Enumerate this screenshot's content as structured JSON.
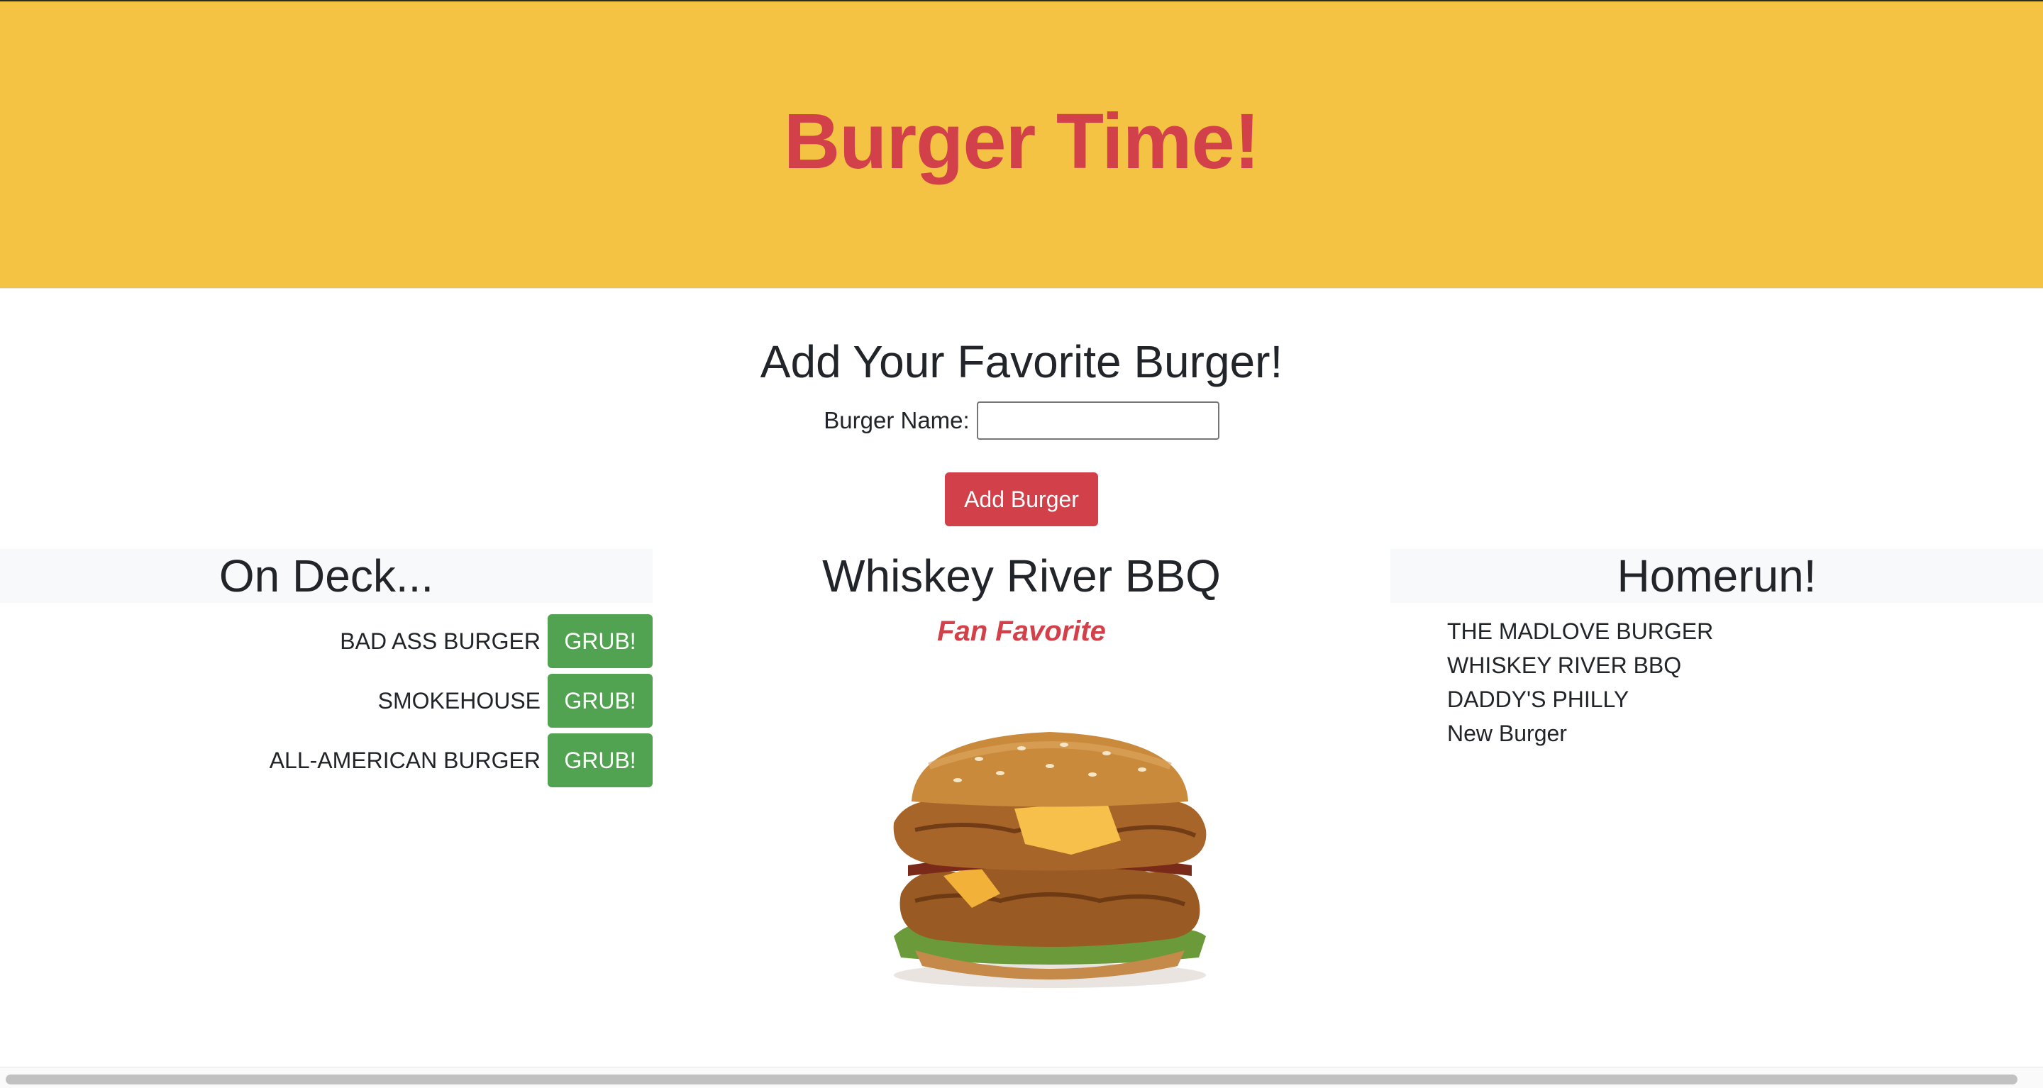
{
  "header": {
    "title": "Burger Time!"
  },
  "form": {
    "heading": "Add Your Favorite Burger!",
    "label": "Burger Name:",
    "input_value": "",
    "input_placeholder": "",
    "submit_label": "Add Burger"
  },
  "on_deck": {
    "heading": "On Deck...",
    "items": [
      {
        "name": "BAD ASS BURGER",
        "button": "GRUB!"
      },
      {
        "name": "SMOKEHOUSE",
        "button": "GRUB!"
      },
      {
        "name": "ALL-AMERICAN BURGER",
        "button": "GRUB!"
      }
    ]
  },
  "feature": {
    "title": "Whiskey River BBQ",
    "subtitle": "Fan Favorite",
    "image_icon": "burger-image"
  },
  "homerun": {
    "heading": "Homerun!",
    "items": [
      "THE MADLOVE BURGER",
      "WHISKEY RIVER BBQ",
      "DADDY'S PHILLY",
      "New Burger"
    ]
  },
  "colors": {
    "hero_bg": "#f5c344",
    "accent_red": "#d2404a",
    "grub_green": "#51a351",
    "panel_header_bg": "#f8f9fa"
  }
}
